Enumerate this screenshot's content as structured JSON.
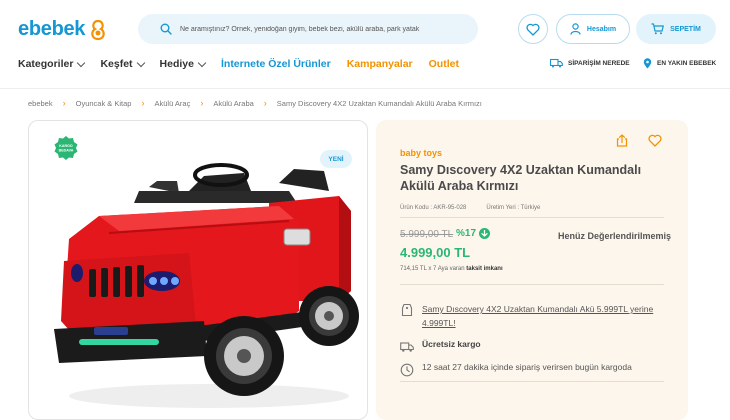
{
  "header": {
    "logo_text": "ebebek",
    "search": {
      "placeholder": "Ne aramıştınız? Örnek, yenidoğan giyim, bebek bezi, akülü araba, park yatak"
    },
    "account_label": "Hesabım",
    "cart_label": "SEPETİM"
  },
  "nav": {
    "items": [
      {
        "label": "Kategoriler",
        "has_caret": true,
        "color": "#333333"
      },
      {
        "label": "Keşfet",
        "has_caret": true,
        "color": "#333333"
      },
      {
        "label": "Hediye",
        "has_caret": true,
        "color": "#333333"
      },
      {
        "label": "İnternete Özel Ürünler",
        "has_caret": false,
        "color": "#1597d3"
      },
      {
        "label": "Kampanyalar",
        "has_caret": false,
        "color": "#f39200"
      },
      {
        "label": "Outlet",
        "has_caret": false,
        "color": "#f39200"
      }
    ],
    "order_tracking": "SİPARİŞİM NEREDE",
    "nearest_store": "EN YAKIN EBEBEK"
  },
  "breadcrumb": [
    "ebebek",
    "Oyuncak & Kitap",
    "Akülü Araç",
    "Akülü Araba",
    "Samy Discovery 4X2 Uzaktan Kumandalı Akülü Araba Kırmızı"
  ],
  "product": {
    "kargo_badge": "KARGO BEDAVA",
    "new_badge": "YENİ",
    "brand": "baby toys",
    "title": "Samy Dıscovery 4X2 Uzaktan Kumandalı Akülü Araba Kırmızı",
    "code": "Ürün Kodu : AKR-95-028",
    "origin": "Üretim Yeri : Türkiye",
    "old_price": "5.999,00 TL",
    "discount": "%17",
    "new_price": "4.999,00 TL",
    "rating_text": "Henüz Değerlendirilmemiş",
    "installment_prefix": "714,15 TL x 7 Aya varan",
    "installment_bold": "taksit imkanı",
    "features": [
      {
        "icon": "tag-icon",
        "text": "Samy Dıscovery 4X2 Uzaktan Kumandalı Akü 5.999TL yerine 4.999TL!",
        "link": true
      },
      {
        "icon": "truck-icon",
        "text": "Ücretsiz kargo",
        "link": false
      },
      {
        "icon": "clock-icon",
        "text": "12 saat 27 dakika içinde sipariş verirsen bugün kargoda",
        "link": false
      }
    ]
  },
  "colors": {
    "brand_blue": "#1597d3",
    "accent_orange": "#f39200",
    "price_green": "#2bb673",
    "panel_bg": "#fdf6ec"
  }
}
